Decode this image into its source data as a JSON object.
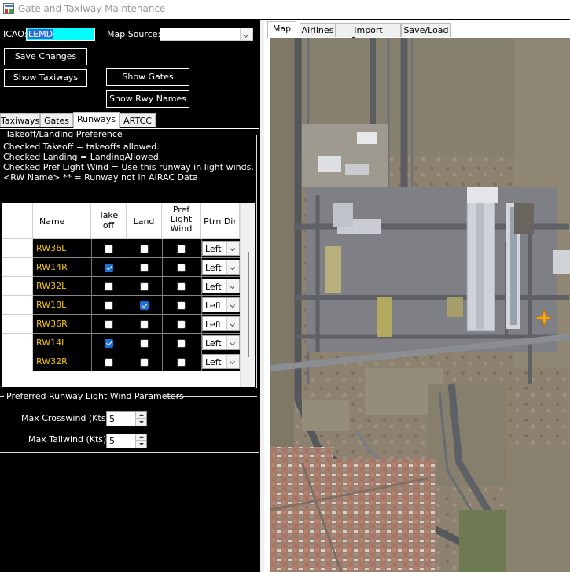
{
  "window": {
    "title": "Gate and Taxiway Maintenance"
  },
  "icao": {
    "label": "ICAO:",
    "value": "LEMD"
  },
  "map_source": {
    "label": "Map Source:",
    "value": ""
  },
  "buttons": {
    "save_changes": "Save Changes",
    "show_taxiways": "Show Taxiways",
    "show_gates": "Show Gates",
    "show_rwy_names": "Show Rwy Names"
  },
  "left_tabs": [
    {
      "label": "Taxiways",
      "active": false
    },
    {
      "label": "Gates",
      "active": false
    },
    {
      "label": "Runways",
      "active": true
    },
    {
      "label": "ARTCC",
      "active": false
    }
  ],
  "right_tabs": [
    {
      "label": "Map",
      "active": true
    },
    {
      "label": "Airlines",
      "active": false
    },
    {
      "label": "Import Scenery",
      "active": false
    },
    {
      "label": "Save/Load",
      "active": false
    }
  ],
  "takeoff_landing": {
    "group_title": "Takeoff/Landing Preference",
    "notes": [
      "Checked Takeoff = takeoffs allowed.",
      "Checked Landing = LandingAllowed.",
      "Checked Pref Light Wind = Use this runway in light winds.",
      "<RW Name> ** = Runway not in AIRAC Data"
    ]
  },
  "runway_table": {
    "headers": {
      "name": "Name",
      "takeoff": "Take off",
      "land": "Land",
      "pref_light_wind": "Pref Light Wind",
      "ptrn_dir": "Ptrn Dir"
    },
    "rows": [
      {
        "name": "RW36L",
        "takeoff": false,
        "land": false,
        "pref": false,
        "dir": "Left"
      },
      {
        "name": "RW14R",
        "takeoff": true,
        "land": false,
        "pref": false,
        "dir": "Left"
      },
      {
        "name": "RW32L",
        "takeoff": false,
        "land": false,
        "pref": false,
        "dir": "Left"
      },
      {
        "name": "RW18L",
        "takeoff": false,
        "land": true,
        "pref": false,
        "dir": "Left"
      },
      {
        "name": "RW36R",
        "takeoff": false,
        "land": false,
        "pref": false,
        "dir": "Left"
      },
      {
        "name": "RW14L",
        "takeoff": true,
        "land": false,
        "pref": false,
        "dir": "Left"
      },
      {
        "name": "RW32R",
        "takeoff": false,
        "land": false,
        "pref": false,
        "dir": "Left"
      }
    ]
  },
  "light_wind": {
    "group_title": "Preferred Runway Light Wind Parameters",
    "max_crosswind_label": "Max Crosswind (Kts):",
    "max_crosswind_value": "5",
    "max_tailwind_label": "Max Tailwind (Kts):",
    "max_tailwind_value": "5"
  },
  "colors": {
    "icao_field_bg": "#00ffff",
    "runway_name_text": "#f5c400",
    "checkbox_checked": "#1e6fd9",
    "aircraft_marker": "#f2a61c"
  }
}
